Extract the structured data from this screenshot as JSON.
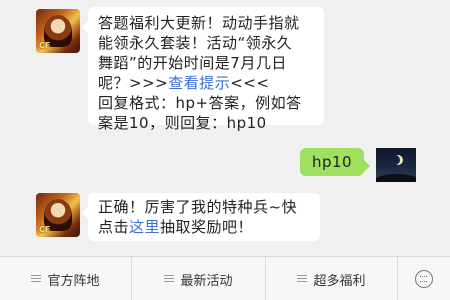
{
  "messages": [
    {
      "from": "bot",
      "lines": [
        "答题福利大更新！动动手指就",
        "能领永久套装！活动“领永久",
        "舞蹈”的开始时间是7月几日"
      ],
      "line4_before": "呢？>>>",
      "line4_link": "查看提示",
      "line4_after": "<<<",
      "lines_after": [
        "回复格式：hp+答案，例如答",
        "案是10，则回复：hp10"
      ]
    },
    {
      "from": "user",
      "text": "hp10"
    },
    {
      "from": "bot",
      "line1": "正确！厉害了我的特种兵~快",
      "line2_before": "点击",
      "line2_link": "这里",
      "line2_after": "抽取奖励吧！"
    }
  ],
  "bottom_bar": {
    "tabs": [
      "官方阵地",
      "最新活动",
      "超多福利"
    ]
  }
}
